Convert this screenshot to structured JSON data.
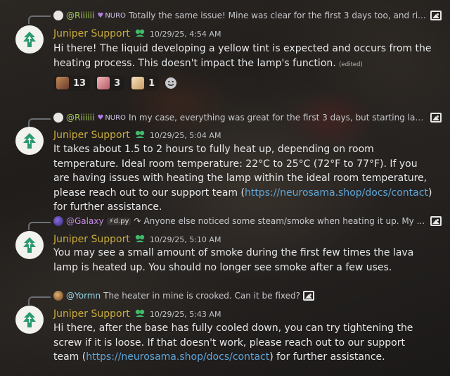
{
  "messages": [
    {
      "reply": {
        "name": "@Riiiiii",
        "tag": "NURO",
        "text": "Totally the same issue!  Mine was clear for the first 3 days too, and ri...",
        "has_image": true
      },
      "author": "Juniper Support",
      "time": "10/29/25, 4:54 AM",
      "text": "Hi there! The liquid developing a yellow tint is expected and occurs from the heating process. This doesn't impact the lamp's function.",
      "edited": "(edited)",
      "reactions": [
        {
          "emoji": "anime-avatar-emoji-1",
          "count": "13"
        },
        {
          "emoji": "anime-avatar-emoji-2",
          "count": "3"
        },
        {
          "emoji": "anime-avatar-emoji-3",
          "count": "1"
        }
      ]
    },
    {
      "reply": {
        "name": "@Riiiiii",
        "tag": "NURO",
        "text": "In my case, everything was great for the first 3 days, but starting last ...",
        "has_image": true
      },
      "author": "Juniper Support",
      "time": "10/29/25, 5:04 AM",
      "text_before_link": "It takes about 1.5 to 2 hours to fully heat up, depending on room temperature. Ideal room temperature: 22°C to 25°C (72°F to 77°F). If you are having issues with heating the lamp within the ideal room temperature, please reach out to our support team (",
      "link": "https://neurosama.shop/docs/contact",
      "text_after_link": ") for further assistance."
    },
    {
      "reply": {
        "name": "@Galaxy",
        "tag": "d.py",
        "text": "Anyone else noticed some steam/smoke when heating it up. My ...",
        "has_image": true
      },
      "author": "Juniper Support",
      "time": "10/29/25, 5:10 AM",
      "text": "You may see a small amount of smoke during the first few times the lava lamp is heated up. You should no longer see smoke after a few uses."
    },
    {
      "reply": {
        "name": "@Yormn",
        "text": "The heater in mine is crooked. Can it be fixed?",
        "has_image": true
      },
      "author": "Juniper Support",
      "time": "10/29/25, 5:43 AM",
      "text_before_link": "Hi there, after the base has fully cooled down, you can try tightening the screw if it is loose. If that doesn't work, please reach out to our support team (",
      "link": "https://neurosama.shop/docs/contact",
      "text_after_link": ") for further assistance."
    }
  ],
  "colors": {
    "author": "#c9ac3c",
    "reply_name_riiiiii": "#a3c85a",
    "reply_name_galaxy": "#c48bea",
    "reply_name_yormn": "#8fd6e8",
    "link": "#5ea6d8",
    "avatar_logo": "#2a9a6e"
  },
  "icons": {
    "avatar": "juniper-tree-logo-icon",
    "role_badge": "green-flower-badge-icon",
    "reply_image": "image-icon",
    "add_reaction": "smiley-add-reaction-icon",
    "reply_command": "reply-arrow-icon"
  }
}
